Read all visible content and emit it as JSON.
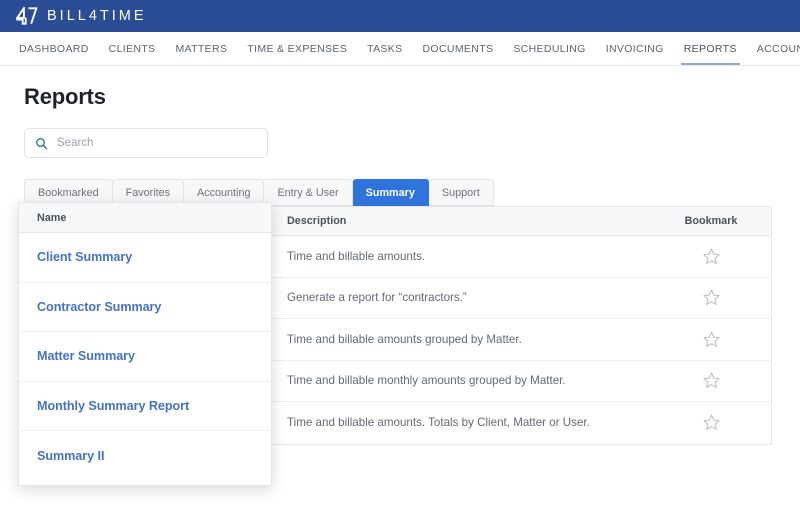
{
  "brand": {
    "logo_icon": "bill4time-47-logo-icon",
    "name": "BILL4TIME"
  },
  "nav": {
    "items": [
      {
        "label": "DASHBOARD",
        "active": false
      },
      {
        "label": "CLIENTS",
        "active": false
      },
      {
        "label": "MATTERS",
        "active": false
      },
      {
        "label": "TIME & EXPENSES",
        "active": false
      },
      {
        "label": "TASKS",
        "active": false
      },
      {
        "label": "DOCUMENTS",
        "active": false
      },
      {
        "label": "SCHEDULING",
        "active": false
      },
      {
        "label": "INVOICING",
        "active": false
      },
      {
        "label": "REPORTS",
        "active": true
      },
      {
        "label": "ACCOUNTING",
        "active": false
      }
    ]
  },
  "page": {
    "title": "Reports"
  },
  "search": {
    "icon": "search-icon",
    "value": "",
    "placeholder": "Search"
  },
  "tabs": [
    {
      "label": "Bookmarked",
      "active": false
    },
    {
      "label": "Favorites",
      "active": false
    },
    {
      "label": "Accounting",
      "active": false
    },
    {
      "label": "Entry & User",
      "active": false
    },
    {
      "label": "Summary",
      "active": true
    },
    {
      "label": "Support",
      "active": false
    }
  ],
  "table": {
    "columns": {
      "name": "Name",
      "description": "Description",
      "bookmark": "Bookmark"
    },
    "bookmark_icon": "star-outline-icon",
    "rows": [
      {
        "name": "Client Summary",
        "description": "Time and billable amounts."
      },
      {
        "name": "Contractor Summary",
        "description": "Generate a report for “contractors.”"
      },
      {
        "name": "Matter Summary",
        "description": "Time and billable amounts grouped by Matter."
      },
      {
        "name": "Monthly Summary Report",
        "description": "Time and billable monthly amounts grouped by Matter."
      },
      {
        "name": "Summary II",
        "description": "Time and billable amounts. Totals by Client, Matter or User."
      }
    ]
  },
  "colors": {
    "brand_bar": "#2a4d96",
    "active_tab": "#2f74dd",
    "link": "#4472c4",
    "nav_underline": "#93a9c8",
    "search_icon": "#2a7f86"
  }
}
